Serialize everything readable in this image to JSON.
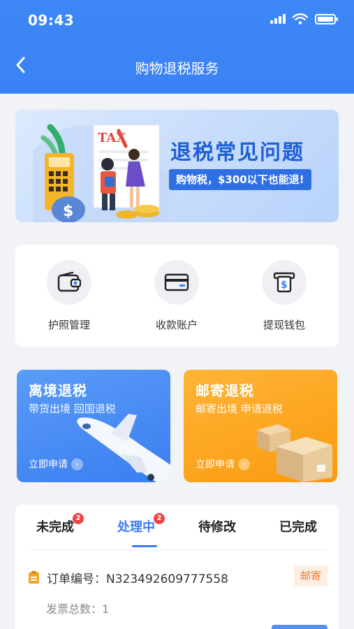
{
  "status_bar": {
    "time": "09:43"
  },
  "nav": {
    "title": "购物退税服务",
    "back_icon": "chevron-left-icon"
  },
  "banner": {
    "title": "退税常见问题",
    "tag": "购物税，$300以下也能退!",
    "art_text": "TAX"
  },
  "quick_actions": [
    {
      "label": "护照管理",
      "icon": "wallet-icon"
    },
    {
      "label": "收款账户",
      "icon": "credit-card-icon"
    },
    {
      "label": "提现钱包",
      "icon": "atm-cash-icon"
    }
  ],
  "promos": [
    {
      "title": "离境退税",
      "subtitle": "带货出境 回国退税",
      "action": "立即申请",
      "color": "#3a7df0"
    },
    {
      "title": "邮寄退税",
      "subtitle": "邮寄出境 申请退税",
      "action": "立即申请",
      "color": "#fb9a10"
    }
  ],
  "tabs": [
    {
      "label": "未完成",
      "badge": "2",
      "active": false
    },
    {
      "label": "处理中",
      "badge": "2",
      "active": true
    },
    {
      "label": "待修改",
      "badge": "",
      "active": false
    },
    {
      "label": "已完成",
      "badge": "",
      "active": false
    }
  ],
  "order": {
    "number": "订单编号：N323492609777558",
    "tag": "邮寄",
    "invoice_count": "发票总数：1"
  },
  "colors": {
    "primary": "#3b82f6",
    "orange": "#fb9a10",
    "badge_red": "#ef4444"
  }
}
